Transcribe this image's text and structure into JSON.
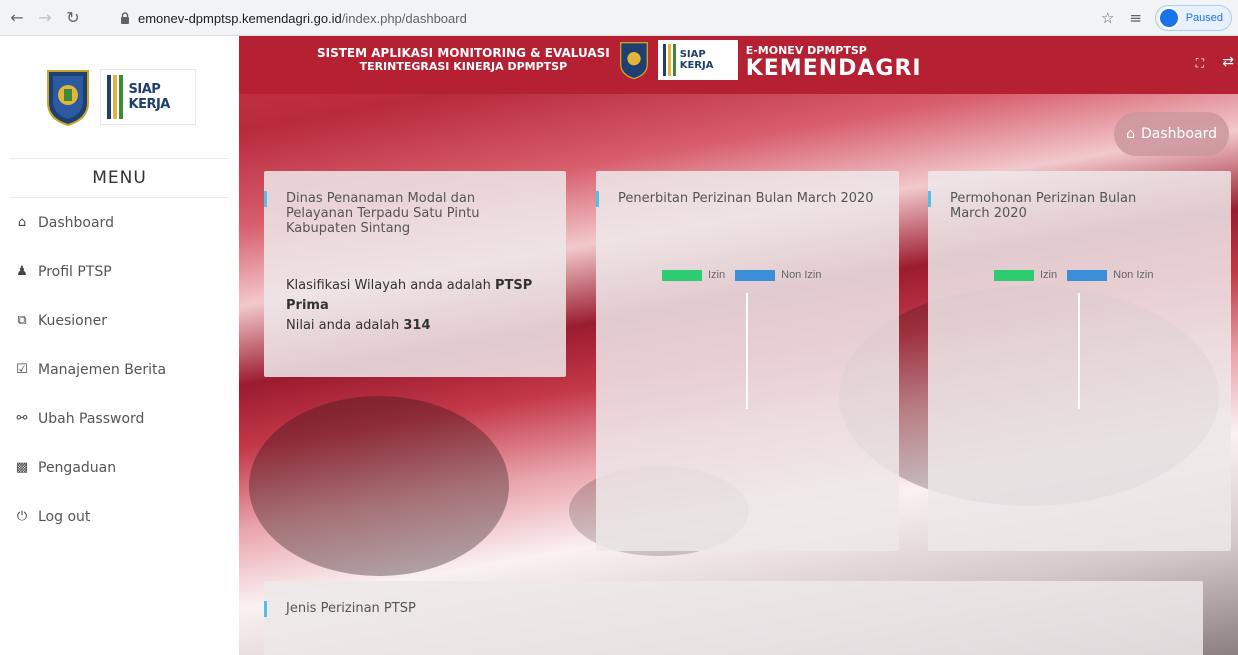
{
  "browser": {
    "url_host": "emonev-dpmptsp.kemendagri.go.id",
    "url_path": "/index.php/dashboard",
    "profile_status": "Paused"
  },
  "sidebar": {
    "logo_text": "SIAP KERJA",
    "menu_title": "MENU",
    "items": [
      {
        "label": "Dashboard",
        "icon": "home-icon"
      },
      {
        "label": "Profil PTSP",
        "icon": "user-icon"
      },
      {
        "label": "Kuesioner",
        "icon": "copy-icon"
      },
      {
        "label": "Manajemen Berita",
        "icon": "calendar-check-icon"
      },
      {
        "label": "Ubah Password",
        "icon": "key-icon"
      },
      {
        "label": "Pengaduan",
        "icon": "comments-icon"
      },
      {
        "label": "Log out",
        "icon": "power-icon"
      }
    ]
  },
  "header": {
    "title_line1": "SISTEM APLIKASI MONITORING & EVALUASI",
    "title_line2": "TERINTEGRASI KINERJA DPMPTSP",
    "logo_text": "SIAP KERJA",
    "app_line1": "E-MONEV DPMPTSP",
    "app_line2": "KEMENDAGRI"
  },
  "breadcrumb": {
    "label": "Dashboard"
  },
  "cards": {
    "info": {
      "title": "Dinas Penanaman Modal dan Pelayanan Terpadu Satu Pintu Kabupaten Sintang",
      "klasifikasi_prefix": "Klasifikasi Wilayah anda adalah ",
      "klasifikasi_value": "PTSP Prima",
      "nilai_prefix": "Nilai anda adalah ",
      "nilai_value": "314"
    },
    "penerbitan": {
      "title": "Penerbitan Perizinan Bulan March 2020"
    },
    "permohonan": {
      "title": "Permohonan Perizinan Bulan March 2020"
    },
    "jenis": {
      "title": "Jenis Perizinan PTSP"
    }
  },
  "legend": {
    "izin": "Izin",
    "non_izin": "Non Izin"
  },
  "colors": {
    "izin": "#2ecc71",
    "non_izin": "#3b8fd8",
    "header_red": "#b52033",
    "accent": "#4fc1e9"
  }
}
